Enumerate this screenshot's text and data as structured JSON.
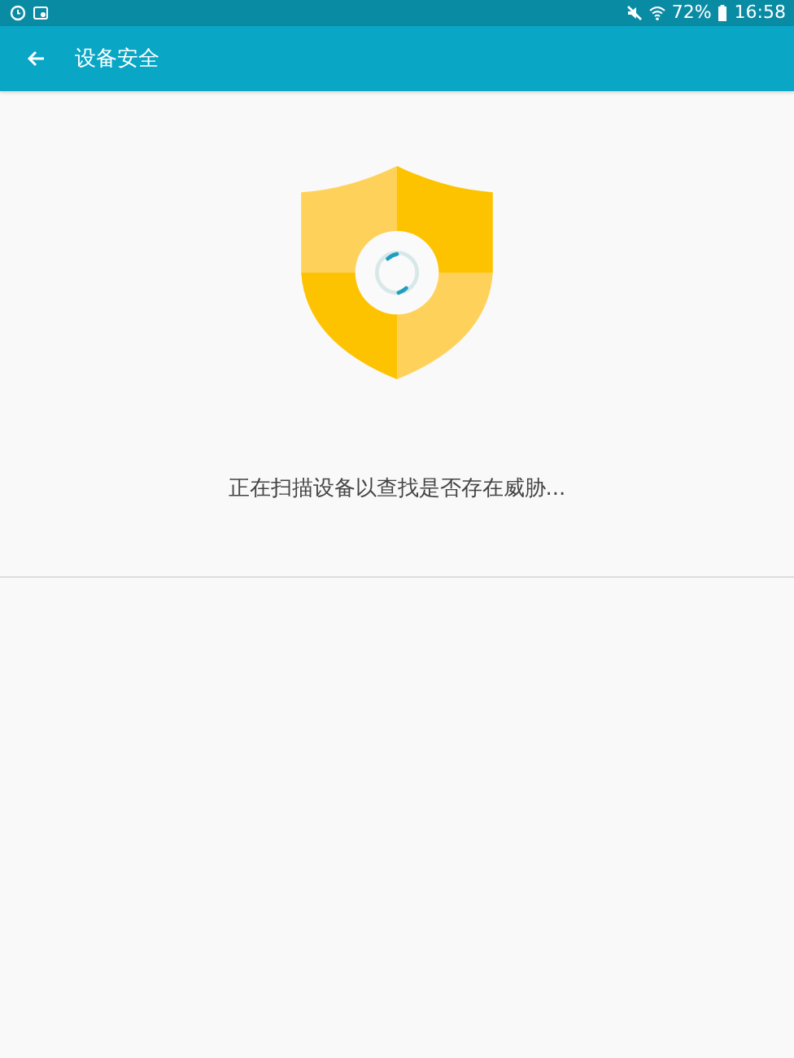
{
  "status_bar": {
    "battery": "72%",
    "time": "16:58"
  },
  "app_bar": {
    "title": "设备安全"
  },
  "scan": {
    "message": "正在扫描设备以查找是否存在威胁..."
  }
}
